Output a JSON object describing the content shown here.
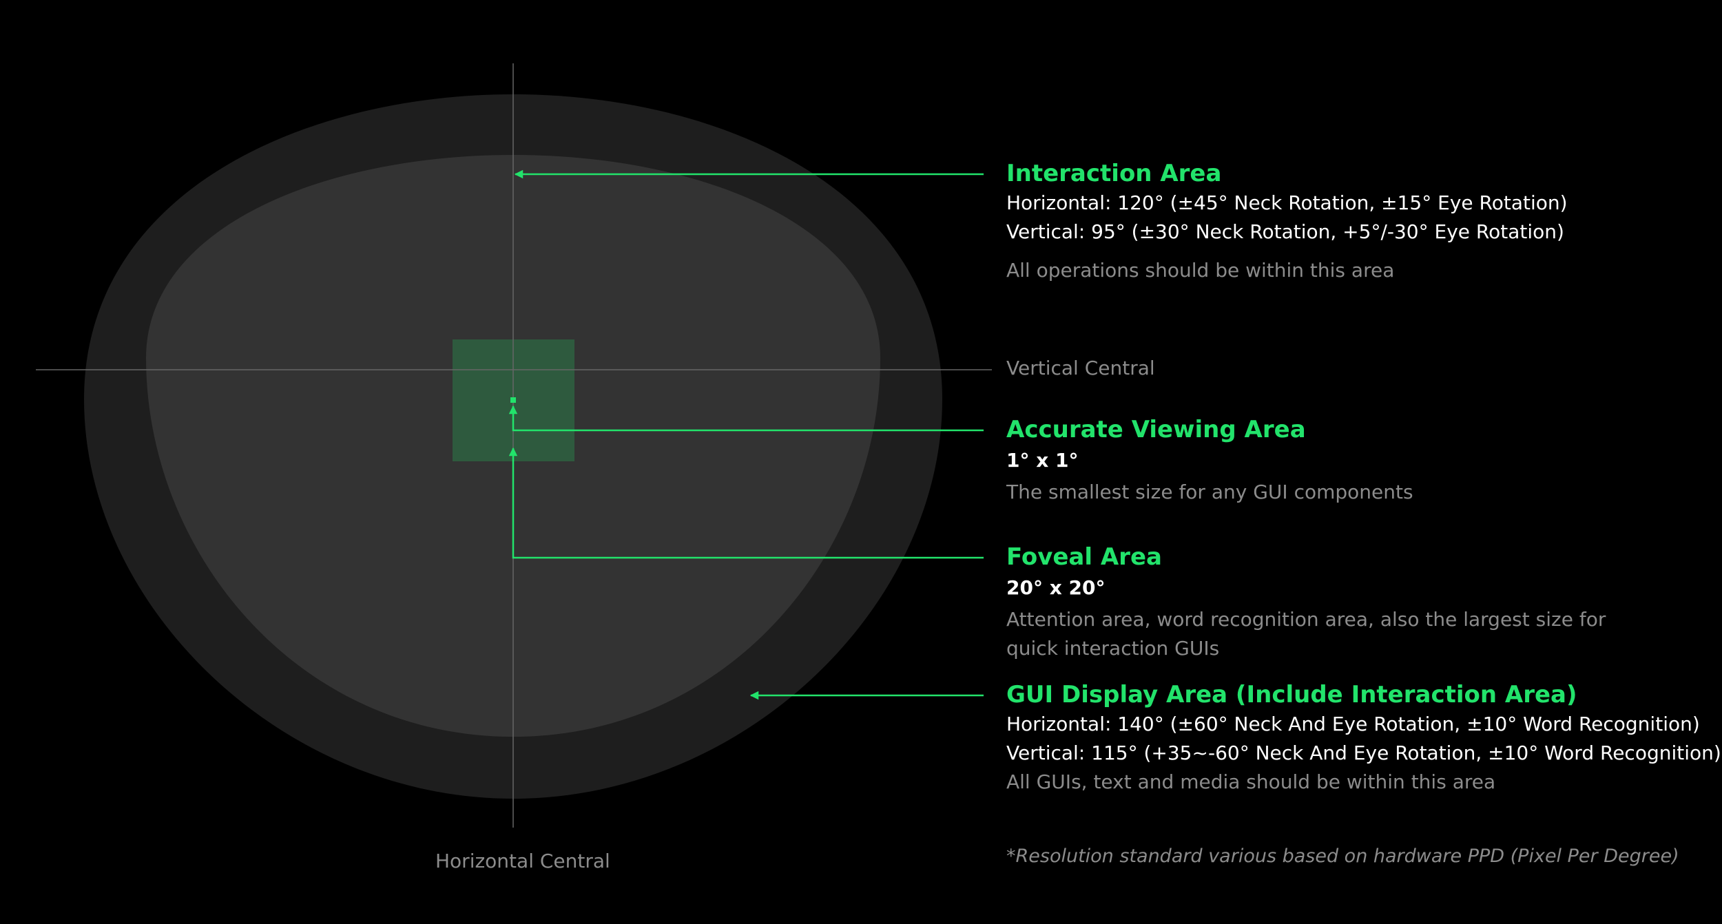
{
  "colors": {
    "background": "#000000",
    "outer_area": "#1e1e1e",
    "inner_area": "#333333",
    "foveal_square": "#2e5a3e",
    "accent_green": "#22e36b",
    "axis_line": "#666666",
    "muted_text": "#8c8c8c",
    "spec_text": "#ffffff"
  },
  "axes": {
    "vertical_central": "Vertical Central",
    "horizontal_central": "Horizontal Central"
  },
  "interaction_area": {
    "title": "Interaction Area",
    "spec_lines": [
      "Horizontal: 120° (±45° Neck Rotation, ±15° Eye Rotation)",
      "Vertical: 95° (±30° Neck Rotation, +5°/-30° Eye Rotation)"
    ],
    "description": "All operations should be within this area"
  },
  "accurate_viewing_area": {
    "title": "Accurate Viewing Area",
    "spec": "1° x 1°",
    "description": "The smallest size for any GUI components"
  },
  "foveal_area": {
    "title": "Foveal Area",
    "spec": "20° x 20°",
    "description": "Attention area, word recognition area, also the largest size for quick interaction GUIs"
  },
  "gui_display_area": {
    "title": "GUI Display Area (Include Interaction Area)",
    "spec_lines": [
      "Horizontal: 140° (±60° Neck And Eye Rotation, ±10° Word Recognition)",
      "Vertical: 115° (+35~-60° Neck And Eye Rotation, ±10° Word Recognition)"
    ],
    "description": "All GUIs, text and media should be within this area"
  },
  "footnote": "*Resolution standard various based on hardware PPD (Pixel Per Degree)"
}
